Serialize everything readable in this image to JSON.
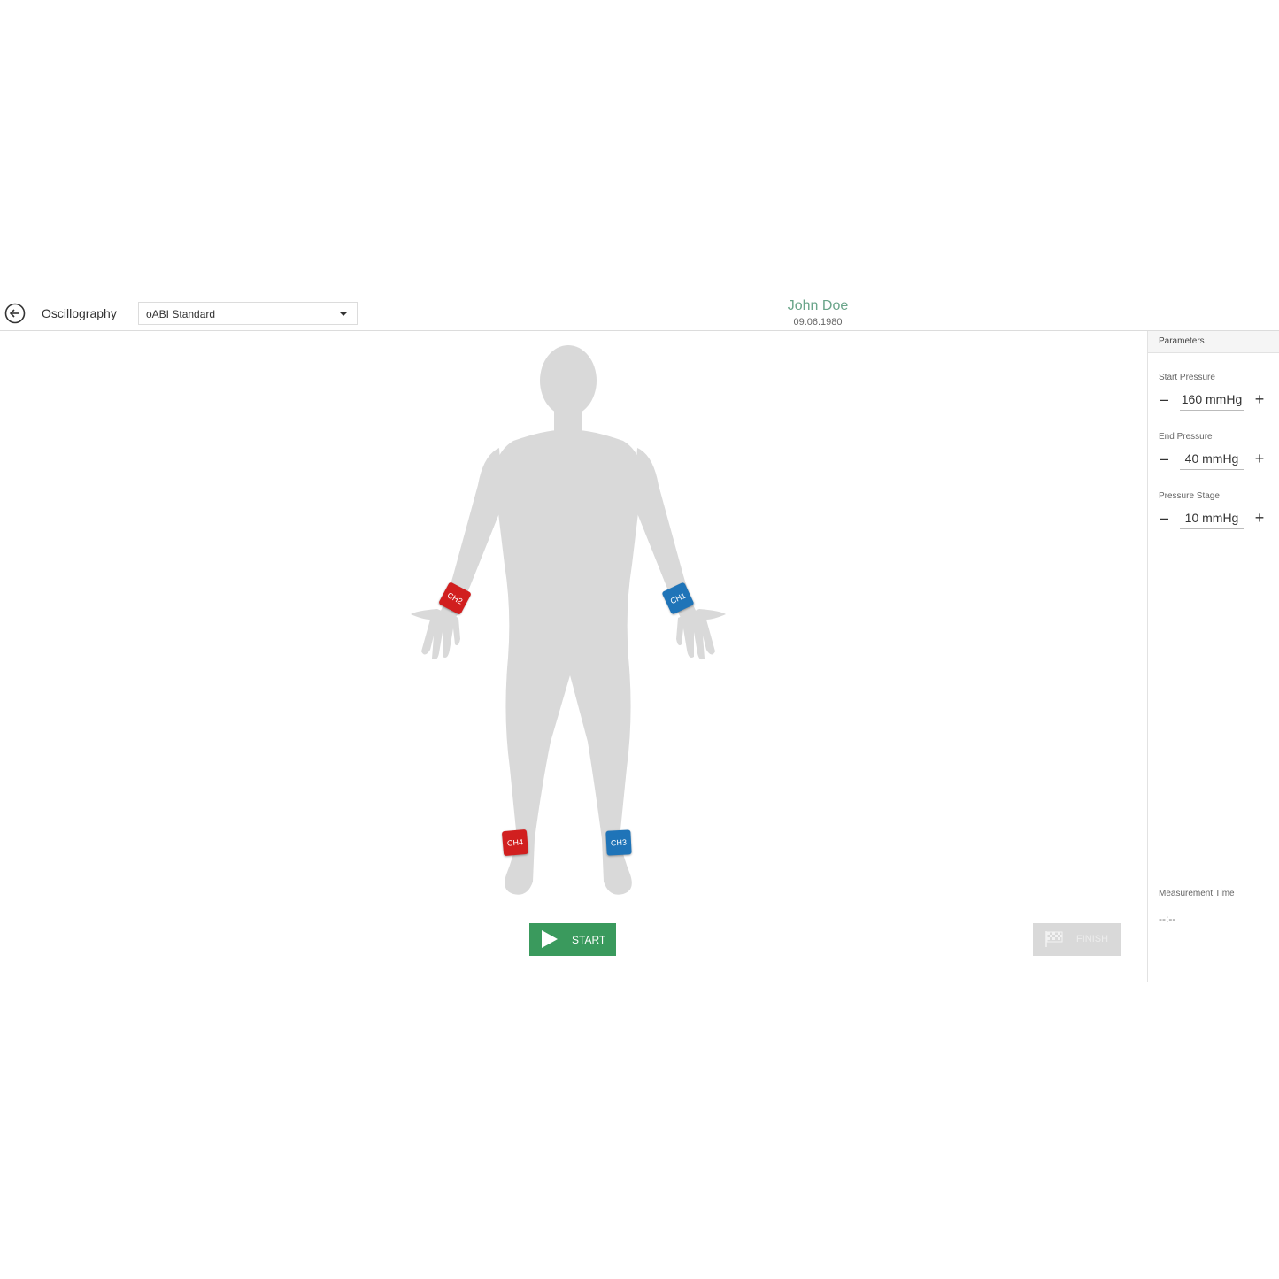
{
  "header": {
    "title": "Oscillography",
    "protocol_select": {
      "value": "oABI Standard"
    },
    "patient": {
      "name": "John Doe",
      "dob": "09.06.1980"
    }
  },
  "cuffs": {
    "ch1": "CH1",
    "ch2": "CH2",
    "ch3": "CH3",
    "ch4": "CH4"
  },
  "actions": {
    "start": "START",
    "finish": "FINISH"
  },
  "panel": {
    "tab": "Parameters",
    "start_pressure": {
      "label": "Start Pressure",
      "value": "160 mmHg",
      "minus": "–",
      "plus": "+"
    },
    "end_pressure": {
      "label": "End Pressure",
      "value": "40 mmHg",
      "minus": "–",
      "plus": "+"
    },
    "pressure_stage": {
      "label": "Pressure Stage",
      "value": "10 mmHg",
      "minus": "–",
      "plus": "+"
    },
    "measurement_time": {
      "label": "Measurement Time",
      "value": "--:--"
    }
  },
  "colors": {
    "accent_green": "#3a9a5d",
    "patient_name": "#6aa58a",
    "cuff_red": "#d11f1f",
    "cuff_blue": "#1f74b8",
    "body_silhouette": "#d9d9d9"
  }
}
